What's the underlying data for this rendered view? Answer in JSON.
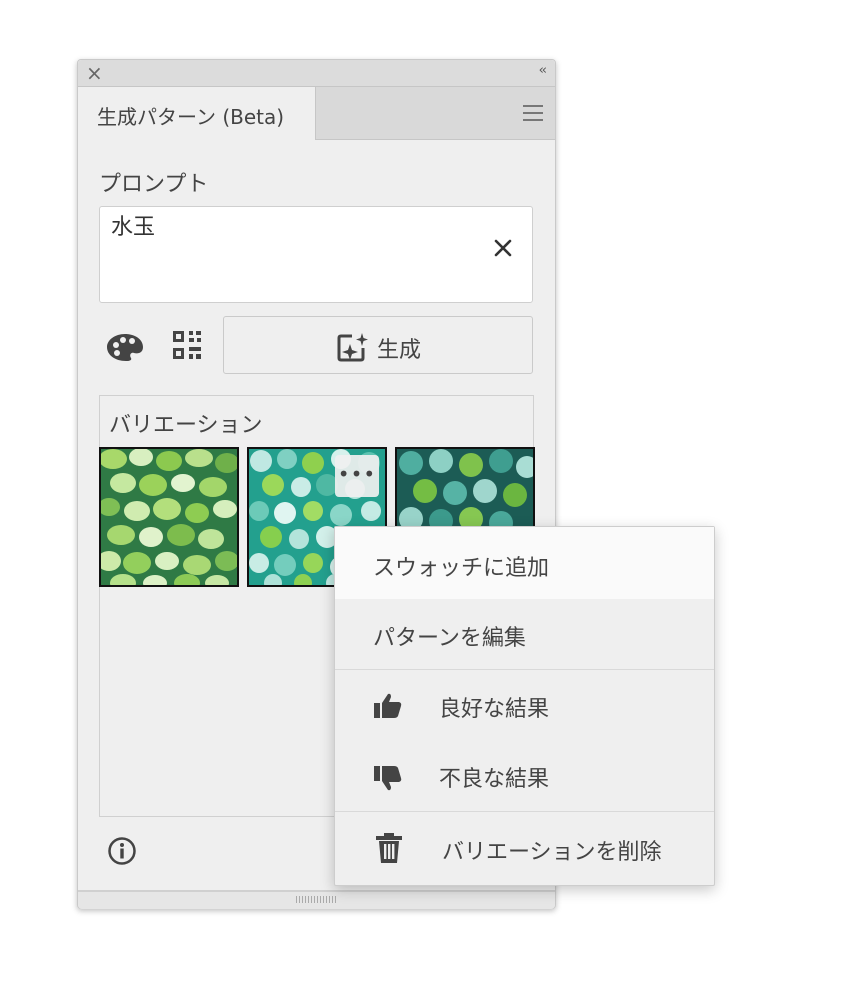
{
  "panel": {
    "tab_title": "生成パターン (Beta)",
    "prompt_label": "プロンプト",
    "prompt_value": "水玉",
    "generate_label": "生成",
    "variations_label": "バリエーション",
    "more_label": "•••"
  },
  "menu": {
    "add_to_swatches": "スウォッチに追加",
    "edit_pattern": "パターンを編集",
    "good_result": "良好な結果",
    "bad_result": "不良な結果",
    "delete_variation": "バリエーションを削除"
  },
  "icons": {
    "close": "close-icon",
    "collapse": "double-chevron-left-icon",
    "panel_menu": "hamburger-menu-icon",
    "clear": "clear-x-icon",
    "color": "palette-icon",
    "density": "qr-grid-icon",
    "generate": "sparkle-frame-icon",
    "info": "info-icon",
    "thumbs_up": "thumbs-up-icon",
    "thumbs_down": "thumbs-down-icon",
    "trash": "trash-icon"
  }
}
